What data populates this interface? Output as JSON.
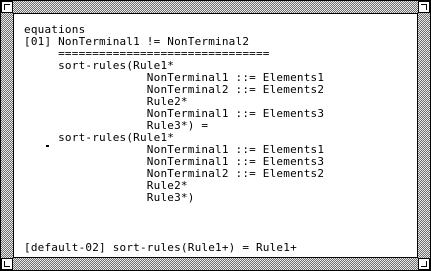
{
  "editor": {
    "lines": [
      "equations",
      "[01] NonTerminal1 != NonTerminal2",
      "     ===============================",
      "     sort-rules(Rule1*",
      "                  NonTerminal1 ::= Elements1",
      "                  NonTerminal2 ::= Elements2",
      "                  Rule2*",
      "                  NonTerminal1 ::= Elements3",
      "                  Rule3*) =",
      "     sort-rules(Rule1*",
      "                  NonTerminal1 ::= Elements1",
      "                  NonTerminal1 ::= Elements3",
      "                  NonTerminal2 ::= Elements2",
      "                  Rule2*",
      "                  Rule3*)",
      "",
      "[default-02] sort-rules(Rule1+) = Rule1+"
    ]
  }
}
